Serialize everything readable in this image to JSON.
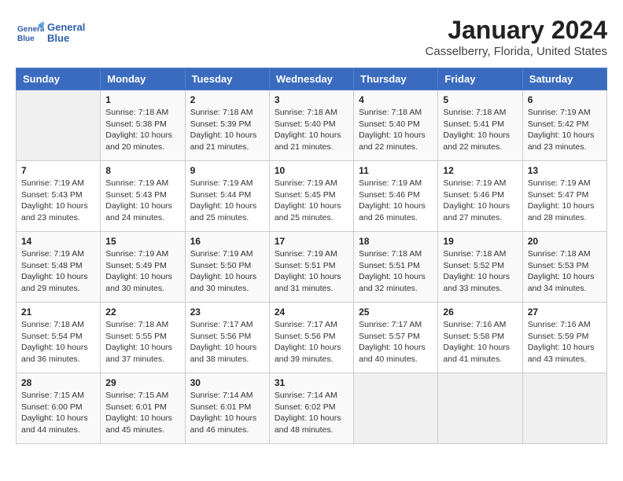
{
  "header": {
    "title": "January 2024",
    "subtitle": "Casselberry, Florida, United States",
    "logo_line1": "General",
    "logo_line2": "Blue"
  },
  "days_of_week": [
    "Sunday",
    "Monday",
    "Tuesday",
    "Wednesday",
    "Thursday",
    "Friday",
    "Saturday"
  ],
  "weeks": [
    [
      {
        "day": "",
        "info": ""
      },
      {
        "day": "1",
        "info": "Sunrise: 7:18 AM\nSunset: 5:38 PM\nDaylight: 10 hours\nand 20 minutes."
      },
      {
        "day": "2",
        "info": "Sunrise: 7:18 AM\nSunset: 5:39 PM\nDaylight: 10 hours\nand 21 minutes."
      },
      {
        "day": "3",
        "info": "Sunrise: 7:18 AM\nSunset: 5:40 PM\nDaylight: 10 hours\nand 21 minutes."
      },
      {
        "day": "4",
        "info": "Sunrise: 7:18 AM\nSunset: 5:40 PM\nDaylight: 10 hours\nand 22 minutes."
      },
      {
        "day": "5",
        "info": "Sunrise: 7:18 AM\nSunset: 5:41 PM\nDaylight: 10 hours\nand 22 minutes."
      },
      {
        "day": "6",
        "info": "Sunrise: 7:19 AM\nSunset: 5:42 PM\nDaylight: 10 hours\nand 23 minutes."
      }
    ],
    [
      {
        "day": "7",
        "info": "Sunrise: 7:19 AM\nSunset: 5:43 PM\nDaylight: 10 hours\nand 23 minutes."
      },
      {
        "day": "8",
        "info": "Sunrise: 7:19 AM\nSunset: 5:43 PM\nDaylight: 10 hours\nand 24 minutes."
      },
      {
        "day": "9",
        "info": "Sunrise: 7:19 AM\nSunset: 5:44 PM\nDaylight: 10 hours\nand 25 minutes."
      },
      {
        "day": "10",
        "info": "Sunrise: 7:19 AM\nSunset: 5:45 PM\nDaylight: 10 hours\nand 25 minutes."
      },
      {
        "day": "11",
        "info": "Sunrise: 7:19 AM\nSunset: 5:46 PM\nDaylight: 10 hours\nand 26 minutes."
      },
      {
        "day": "12",
        "info": "Sunrise: 7:19 AM\nSunset: 5:46 PM\nDaylight: 10 hours\nand 27 minutes."
      },
      {
        "day": "13",
        "info": "Sunrise: 7:19 AM\nSunset: 5:47 PM\nDaylight: 10 hours\nand 28 minutes."
      }
    ],
    [
      {
        "day": "14",
        "info": "Sunrise: 7:19 AM\nSunset: 5:48 PM\nDaylight: 10 hours\nand 29 minutes."
      },
      {
        "day": "15",
        "info": "Sunrise: 7:19 AM\nSunset: 5:49 PM\nDaylight: 10 hours\nand 30 minutes."
      },
      {
        "day": "16",
        "info": "Sunrise: 7:19 AM\nSunset: 5:50 PM\nDaylight: 10 hours\nand 30 minutes."
      },
      {
        "day": "17",
        "info": "Sunrise: 7:19 AM\nSunset: 5:51 PM\nDaylight: 10 hours\nand 31 minutes."
      },
      {
        "day": "18",
        "info": "Sunrise: 7:18 AM\nSunset: 5:51 PM\nDaylight: 10 hours\nand 32 minutes."
      },
      {
        "day": "19",
        "info": "Sunrise: 7:18 AM\nSunset: 5:52 PM\nDaylight: 10 hours\nand 33 minutes."
      },
      {
        "day": "20",
        "info": "Sunrise: 7:18 AM\nSunset: 5:53 PM\nDaylight: 10 hours\nand 34 minutes."
      }
    ],
    [
      {
        "day": "21",
        "info": "Sunrise: 7:18 AM\nSunset: 5:54 PM\nDaylight: 10 hours\nand 36 minutes."
      },
      {
        "day": "22",
        "info": "Sunrise: 7:18 AM\nSunset: 5:55 PM\nDaylight: 10 hours\nand 37 minutes."
      },
      {
        "day": "23",
        "info": "Sunrise: 7:17 AM\nSunset: 5:56 PM\nDaylight: 10 hours\nand 38 minutes."
      },
      {
        "day": "24",
        "info": "Sunrise: 7:17 AM\nSunset: 5:56 PM\nDaylight: 10 hours\nand 39 minutes."
      },
      {
        "day": "25",
        "info": "Sunrise: 7:17 AM\nSunset: 5:57 PM\nDaylight: 10 hours\nand 40 minutes."
      },
      {
        "day": "26",
        "info": "Sunrise: 7:16 AM\nSunset: 5:58 PM\nDaylight: 10 hours\nand 41 minutes."
      },
      {
        "day": "27",
        "info": "Sunrise: 7:16 AM\nSunset: 5:59 PM\nDaylight: 10 hours\nand 43 minutes."
      }
    ],
    [
      {
        "day": "28",
        "info": "Sunrise: 7:15 AM\nSunset: 6:00 PM\nDaylight: 10 hours\nand 44 minutes."
      },
      {
        "day": "29",
        "info": "Sunrise: 7:15 AM\nSunset: 6:01 PM\nDaylight: 10 hours\nand 45 minutes."
      },
      {
        "day": "30",
        "info": "Sunrise: 7:14 AM\nSunset: 6:01 PM\nDaylight: 10 hours\nand 46 minutes."
      },
      {
        "day": "31",
        "info": "Sunrise: 7:14 AM\nSunset: 6:02 PM\nDaylight: 10 hours\nand 48 minutes."
      },
      {
        "day": "",
        "info": ""
      },
      {
        "day": "",
        "info": ""
      },
      {
        "day": "",
        "info": ""
      }
    ]
  ]
}
